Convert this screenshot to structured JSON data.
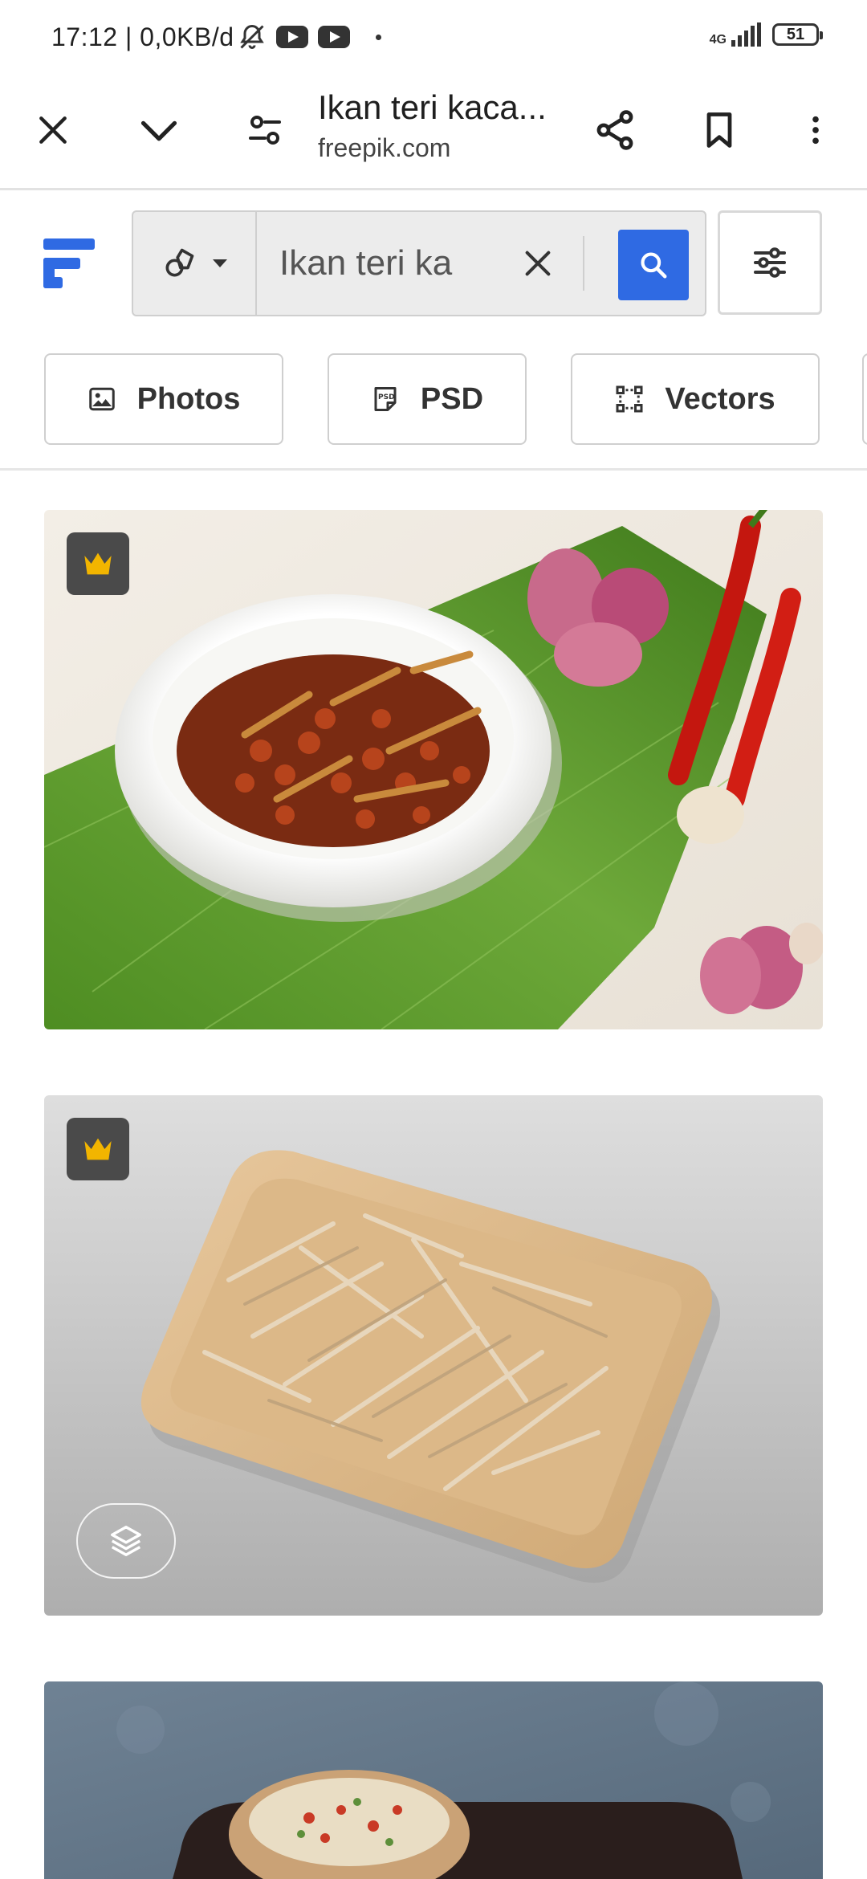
{
  "status_bar": {
    "time": "17:12",
    "speed": "| 0,0KB/d",
    "network": "4G",
    "battery": "51"
  },
  "browser": {
    "page_title": "Ikan teri kaca...",
    "domain": "freepik.com",
    "icons": [
      "close-icon",
      "chevron-down-icon",
      "page-settings-icon",
      "share-icon",
      "bookmark-icon",
      "more-vert-icon"
    ]
  },
  "search": {
    "query": "Ikan teri ka",
    "accent_color": "#2f6ae3"
  },
  "chips": [
    {
      "label": "Photos",
      "icon": "image-icon"
    },
    {
      "label": "PSD",
      "icon": "psd-file-icon"
    },
    {
      "label": "Vectors",
      "icon": "vector-icon"
    }
  ],
  "results": [
    {
      "subject": "fried anchovies with peanuts in bowl on banana leaf",
      "badge": "premium-crown-icon"
    },
    {
      "subject": "dried anchovies on wooden tray",
      "badge": "premium-crown-icon",
      "extra_icon": "layers-icon"
    },
    {
      "subject": "dish on dark plate",
      "badge": ""
    }
  ],
  "colors": {
    "premium_badge_bg": "#4a4a4a",
    "crown": "#f2b500",
    "logo": "#2f6ae3"
  }
}
